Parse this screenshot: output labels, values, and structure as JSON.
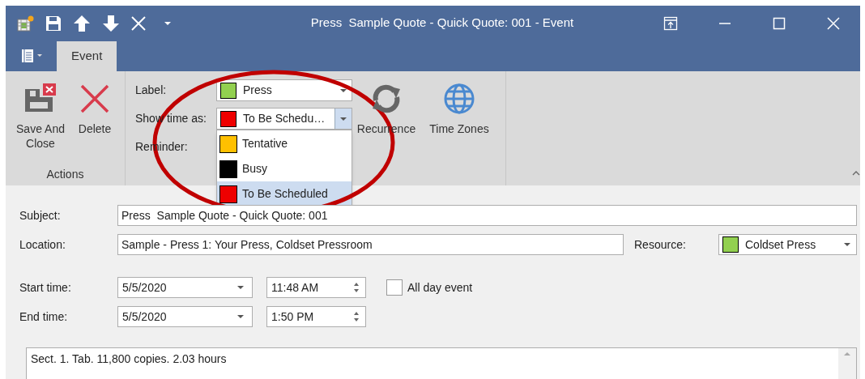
{
  "window": {
    "title": "Press  Sample Quote - Quick Quote: 001 - Event"
  },
  "ribbon": {
    "tabs": [
      {
        "label": "Event",
        "selected": true
      }
    ],
    "actions": {
      "label": "Actions",
      "buttons": [
        {
          "kind": "save_close",
          "label": "Save And Close"
        },
        {
          "kind": "delete",
          "label": "Delete"
        }
      ]
    },
    "label_field": {
      "label": "Label:",
      "value": "Press",
      "color": "#92d050"
    },
    "show_time_as": {
      "label": "Show time as:",
      "value": "To Be Schedu…",
      "color": "#ee0000",
      "expanded": true,
      "options": [
        {
          "label": "Tentative",
          "color": "#ffc000",
          "selected": false
        },
        {
          "label": "Busy",
          "color": "#000000",
          "selected": false
        },
        {
          "label": "To Be Scheduled",
          "color": "#ee0000",
          "selected": true
        }
      ]
    },
    "reminder": {
      "label": "Reminder:"
    },
    "buttons": [
      {
        "kind": "recurrence",
        "label": "Recurrence"
      },
      {
        "kind": "time_zones",
        "label": "Time Zones"
      }
    ]
  },
  "form": {
    "subject": {
      "label": "Subject:",
      "value": "Press  Sample Quote - Quick Quote: 001"
    },
    "location": {
      "label": "Location:",
      "value": "Sample - Press 1: Your Press, Coldset Pressroom"
    },
    "resource": {
      "label": "Resource:",
      "value": "Coldset Press",
      "color": "#92d050"
    },
    "start_time": {
      "label": "Start time:",
      "date": "5/5/2020",
      "time": "11:48 AM"
    },
    "end_time": {
      "label": "End time:",
      "date": "5/5/2020",
      "time": "1:50 PM"
    },
    "all_day_event": {
      "label": "All day event",
      "checked": false
    },
    "notes": "Sect. 1. Tab. 11,800 copies. 2.03 hours"
  },
  "annotation": {
    "kind": "ellipse"
  }
}
